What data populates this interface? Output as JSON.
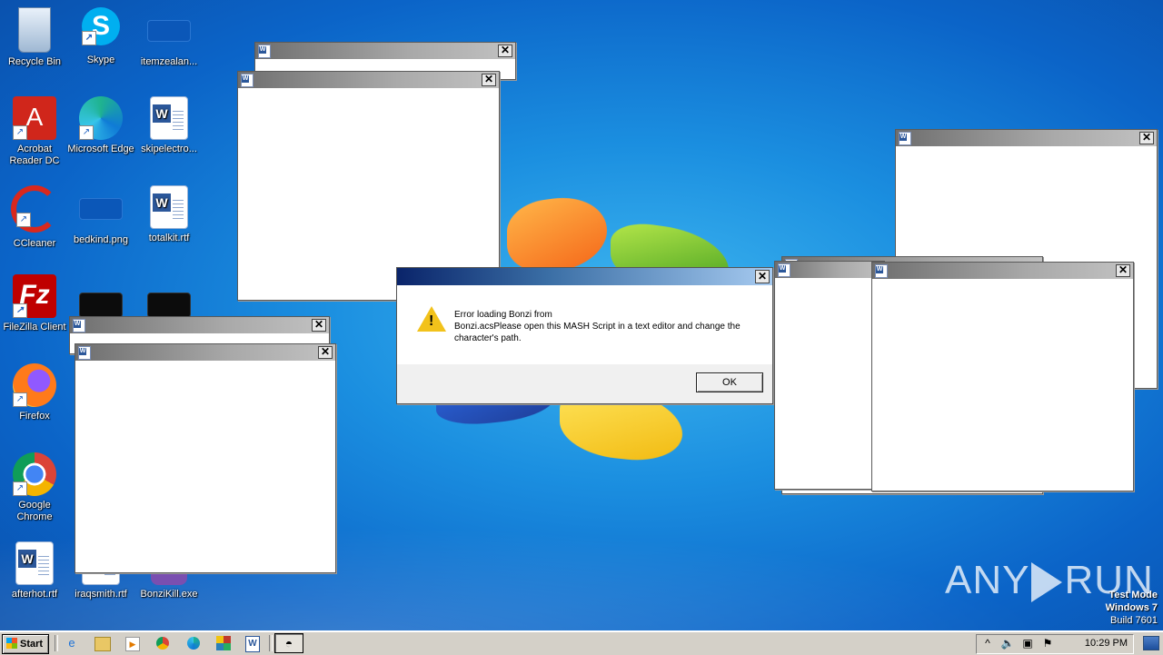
{
  "desktop": {
    "icons": [
      {
        "label": "Recycle Bin",
        "icon": "recycle-bin-icon"
      },
      {
        "label": "Skype",
        "icon": "skype-icon"
      },
      {
        "label": "itemzealan...",
        "icon": "image-file-icon"
      },
      {
        "label": "Acrobat Reader DC",
        "icon": "acrobat-icon"
      },
      {
        "label": "Microsoft Edge",
        "icon": "edge-icon"
      },
      {
        "label": "skipelectro...",
        "icon": "word-doc-icon"
      },
      {
        "label": "CCleaner",
        "icon": "ccleaner-icon"
      },
      {
        "label": "bedkind.png",
        "icon": "image-file-icon"
      },
      {
        "label": "totalkit.rtf",
        "icon": "word-doc-icon"
      },
      {
        "label": "FileZilla Client",
        "icon": "filezilla-icon"
      },
      {
        "label": "Firefox",
        "icon": "firefox-icon"
      },
      {
        "label": "Google Chrome",
        "icon": "chrome-icon"
      },
      {
        "label": "afterhot.rtf",
        "icon": "word-doc-icon"
      },
      {
        "label": "iraqsmith.rtf",
        "icon": "word-doc-icon"
      },
      {
        "label": "BonziKill.exe",
        "icon": "bonzi-icon"
      }
    ]
  },
  "dialog": {
    "message_line1": "Error loading Bonzi from",
    "message_line2": "Bonzi.acsPlease open this MASH Script in a text editor and change the character's path.",
    "ok_label": "OK",
    "close_glyph": "✕"
  },
  "window_close_glyph": "✕",
  "watermark": {
    "left": "ANY",
    "right": "RUN",
    "test_mode": "Test Mode",
    "os": "Windows 7",
    "build": "Build 7601"
  },
  "taskbar": {
    "start_label": "Start",
    "clock": "10:29 PM"
  },
  "colors": {
    "desktop_blue": "#1b8fe0",
    "dialog_title": "#0a246a",
    "taskbar": "#d4d0c8"
  }
}
